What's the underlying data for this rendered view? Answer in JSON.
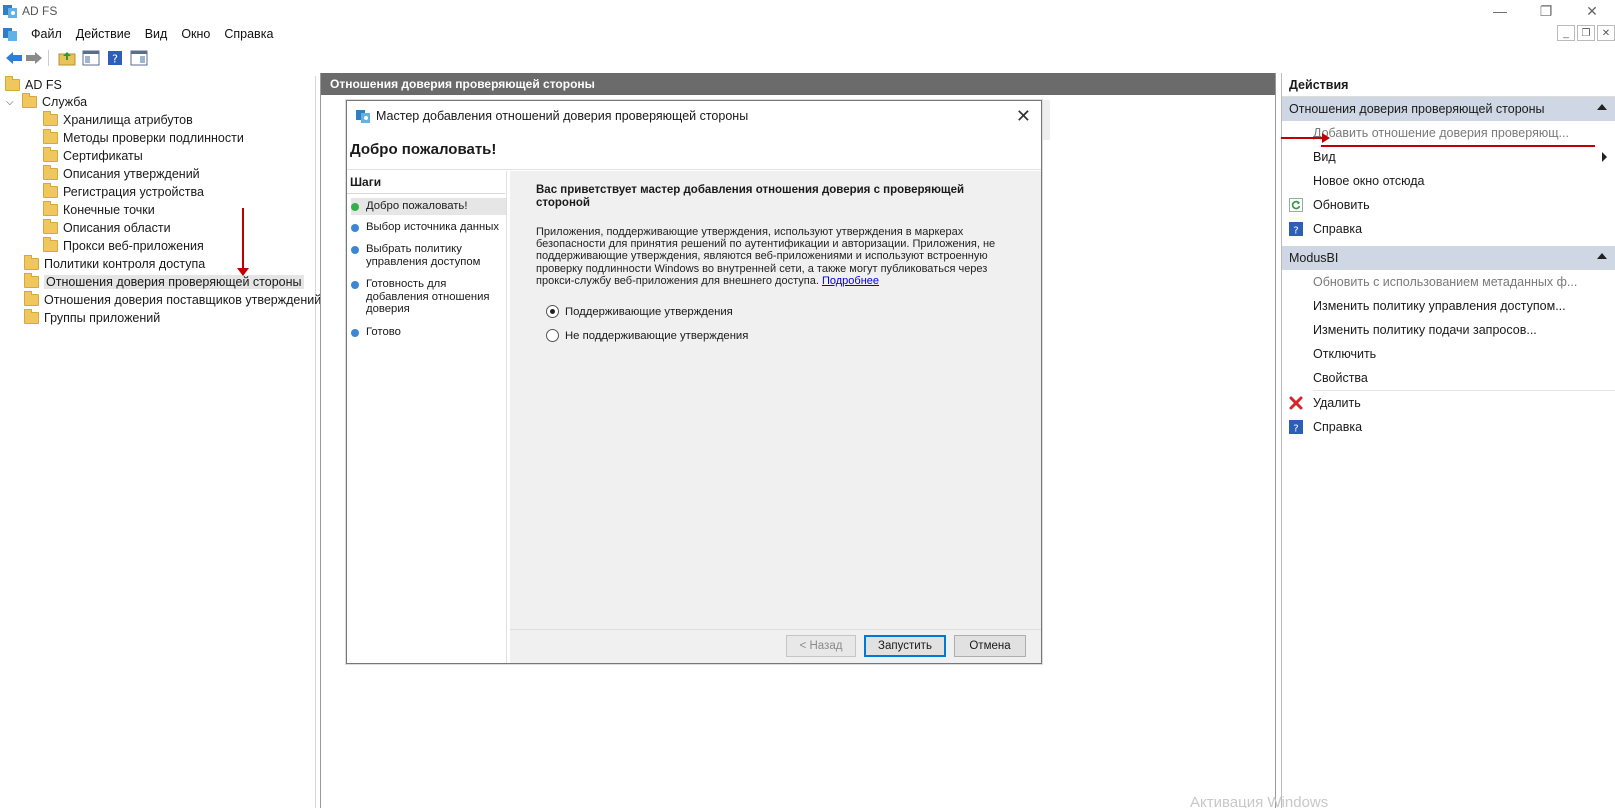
{
  "window": {
    "title": "AD FS",
    "controls": {
      "minimize": "—",
      "restore": "❐",
      "close": "✕"
    }
  },
  "menu": {
    "items": [
      "Файл",
      "Действие",
      "Вид",
      "Окно",
      "Справка"
    ]
  },
  "tree": {
    "root": "AD FS",
    "service": "Служба",
    "service_children": [
      "Хранилища атрибутов",
      "Методы проверки подлинности",
      "Сертификаты",
      "Описания утверждений",
      "Регистрация устройства",
      "Конечные точки",
      "Описания области",
      "Прокси веб-приложения"
    ],
    "top_items": [
      "Политики контроля доступа",
      "Отношения доверия проверяющей стороны",
      "Отношения доверия поставщиков утверждений",
      "Группы приложений"
    ],
    "selected": "Отношения доверия проверяющей стороны"
  },
  "center": {
    "header": "Отношения доверия проверяющей стороны"
  },
  "wizard": {
    "title": "Мастер добавления отношений доверия проверяющей стороны",
    "welcome": "Добро пожаловать!",
    "steps_title": "Шаги",
    "steps": [
      "Добро пожаловать!",
      "Выбор источника данных",
      "Выбрать политику управления доступом",
      "Готовность для добавления отношения доверия",
      "Готово"
    ],
    "heading": "Вас приветствует мастер добавления отношения доверия с проверяющей стороной",
    "paragraph": "Приложения, поддерживающие утверждения, используют утверждения в маркерах безопасности для принятия решений по аутентификации и авторизации. Приложения, не поддерживающие утверждения, являются веб-приложениями и используют встроенную проверку подлинности Windows во внутренней сети, а также могут публиковаться через прокси-службу веб-приложения для внешнего доступа.",
    "link": "Подробнее",
    "options": [
      {
        "label": "Поддерживающие утверждения",
        "checked": true
      },
      {
        "label": "Не поддерживающие утверждения",
        "checked": false
      }
    ],
    "buttons": {
      "back": "< Назад",
      "start": "Запустить",
      "cancel": "Отмена"
    }
  },
  "actions": {
    "header": "Действия",
    "section1": {
      "title": "Отношения доверия проверяющей стороны",
      "items": [
        {
          "label": "Добавить отношение доверия проверяющ...",
          "disabled": true,
          "icon": ""
        },
        {
          "label": "Вид",
          "disabled": false,
          "icon": "",
          "submenu": true
        },
        {
          "label": "Новое окно отсюда",
          "disabled": false,
          "icon": ""
        },
        {
          "label": "Обновить",
          "disabled": false,
          "icon": "refresh-icon"
        },
        {
          "label": "Справка",
          "disabled": false,
          "icon": "help-icon"
        }
      ]
    },
    "section2": {
      "title": "ModusBI",
      "items": [
        {
          "label": "Обновить с использованием метаданных ф...",
          "disabled": true,
          "icon": ""
        },
        {
          "label": "Изменить политику управления доступом...",
          "disabled": false,
          "icon": ""
        },
        {
          "label": "Изменить политику подачи запросов...",
          "disabled": false,
          "icon": ""
        },
        {
          "label": "Отключить",
          "disabled": false,
          "icon": ""
        },
        {
          "label": "Свойства",
          "disabled": false,
          "icon": ""
        },
        {
          "label": "Удалить",
          "disabled": false,
          "icon": "delete-icon"
        },
        {
          "label": "Справка",
          "disabled": false,
          "icon": "help-icon"
        }
      ]
    }
  },
  "watermark": "Активация Windows",
  "colors": {
    "annotation_red": "#c00000",
    "section_bg": "#cfd7e4",
    "center_header_bg": "#6b6b6b"
  }
}
